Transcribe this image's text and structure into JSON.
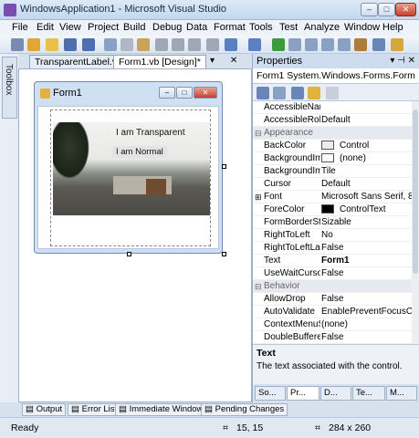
{
  "window": {
    "title": "WindowsApplication1 - Microsoft Visual Studio",
    "min": "–",
    "max": "□",
    "close": "✕"
  },
  "menu": [
    "File",
    "Edit",
    "View",
    "Project",
    "Build",
    "Debug",
    "Data",
    "Format",
    "Tools",
    "Test",
    "Analyze",
    "Window",
    "Help"
  ],
  "toolbox": {
    "label": "Toolbox"
  },
  "tabs": {
    "tab1": "TransparentLabel.vb",
    "tab2": "Form1.vb [Design]*",
    "dropdown": "▾",
    "close": "✕"
  },
  "form": {
    "title": "Form1",
    "min": "–",
    "max": "□",
    "close": "✕",
    "label_transparent": "I am Transparent",
    "label_normal": "I am Normal"
  },
  "properties": {
    "header": "Properties",
    "header_pin": "▾ ⊣ ✕",
    "selector": "Form1 System.Windows.Forms.Form",
    "rows": [
      {
        "name": "AccessibleNam",
        "value": "",
        "cat": false
      },
      {
        "name": "AccessibleRole",
        "value": "Default",
        "cat": false
      },
      {
        "name": "Appearance",
        "value": "",
        "cat": true
      },
      {
        "name": "BackColor",
        "value": "Control",
        "cat": false,
        "swatch": "#ececec"
      },
      {
        "name": "BackgroundIma",
        "value": "(none)",
        "cat": false,
        "swatch": "#ffffff"
      },
      {
        "name": "BackgroundIma",
        "value": "Tile",
        "cat": false
      },
      {
        "name": "Cursor",
        "value": "Default",
        "cat": false
      },
      {
        "name": "Font",
        "value": "Microsoft Sans Serif, 8.",
        "cat": false
      },
      {
        "name": "ForeColor",
        "value": "ControlText",
        "cat": false,
        "swatch": "#000000"
      },
      {
        "name": "FormBorderSty",
        "value": "Sizable",
        "cat": false
      },
      {
        "name": "RightToLeft",
        "value": "No",
        "cat": false
      },
      {
        "name": "RightToLeftLay",
        "value": "False",
        "cat": false
      },
      {
        "name": "Text",
        "value": "Form1",
        "cat": false,
        "bold": true
      },
      {
        "name": "UseWaitCursor",
        "value": "False",
        "cat": false
      },
      {
        "name": "Behavior",
        "value": "",
        "cat": true
      },
      {
        "name": "AllowDrop",
        "value": "False",
        "cat": false
      },
      {
        "name": "AutoValidate",
        "value": "EnablePreventFocusCh",
        "cat": false
      },
      {
        "name": "ContextMenuSt",
        "value": "(none)",
        "cat": false
      },
      {
        "name": "DoubleBuffere",
        "value": "False",
        "cat": false
      }
    ],
    "desc_title": "Text",
    "desc_text": "The text associated with the control.",
    "bottom_tabs": [
      "So...",
      "Pr...",
      "D...",
      "Te...",
      "M..."
    ]
  },
  "panels": [
    "Output",
    "Error List",
    "Immediate Window",
    "Pending Changes"
  ],
  "status": {
    "ready": "Ready",
    "position": "15, 15",
    "size": "284 x 260"
  },
  "colors": {
    "accent": "#cfdcef",
    "close": "#c4412b"
  }
}
